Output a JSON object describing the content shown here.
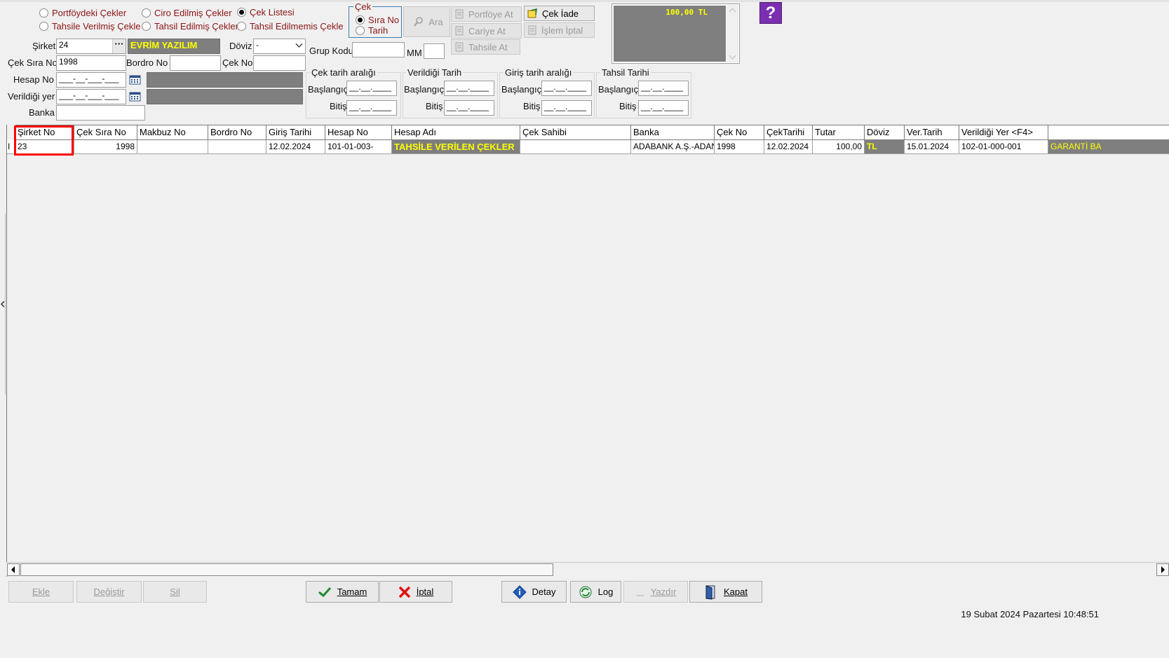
{
  "filters": {
    "radios": [
      {
        "label": "Portföydeki Çekler",
        "selected": false
      },
      {
        "label": "Ciro Edilmiş Çekler",
        "selected": false
      },
      {
        "label": "Çek Listesi",
        "selected": true
      },
      {
        "label": "Tahsile Verilmiş Çekle",
        "selected": false
      },
      {
        "label": "Tahsil Edilmiş Çekler",
        "selected": false
      },
      {
        "label": "Tahsil Edilmemis Çekle",
        "selected": false
      }
    ]
  },
  "form": {
    "sirket_label": "Şirket",
    "sirket_value": "24",
    "sirket_name": "EVRİM YAZILIM",
    "doviz_label": "Döviz",
    "doviz_value": "-",
    "cek_sira_label": "Çek Sıra No",
    "cek_sira_value": "1998",
    "bordro_label": "Bordro No",
    "bordro_value": "",
    "cek_no_label": "Çek No",
    "cek_no_value": "",
    "hesap_label": "Hesap No",
    "hesap_value": "___-__-___-___",
    "verildigi_label": "Verildiği yer",
    "verildigi_value": "___-__-___-___",
    "banka_label": "Banka",
    "banka_value": "",
    "grup_label": "Grup Kodu",
    "grup_value": "",
    "mm_label": "MM",
    "mm_value": ""
  },
  "cek_group": {
    "title": "Çek",
    "opt1": "Sıra No",
    "opt2": "Tarih"
  },
  "buttons": {
    "ara": "Ara",
    "portfoye": "Portföye At",
    "cariye": "Cariye At",
    "tahsile": "Tahsile At",
    "cek_iade": "Çek İade",
    "islem_iptal": "İşlem İptal"
  },
  "total_display": "100,00 TL",
  "date_groups": [
    {
      "title": "Çek tarih aralığı",
      "start_label": "Başlangıç",
      "end_label": "Bitiş",
      "start": "__.__.____",
      "end": "__.__.____"
    },
    {
      "title": "Verildiği Tarih",
      "start_label": "Başlangıç",
      "end_label": "Bitiş",
      "start": "__.__.____",
      "end": "__.__.____"
    },
    {
      "title": "Giriş tarih aralığı",
      "start_label": "Başlangıç",
      "end_label": "Bitiş",
      "start": "__.__.____",
      "end": "__.__.____"
    },
    {
      "title": "Tahsil Tarihi",
      "start_label": "Başlangıç",
      "end_label": "Bitiş",
      "start": "__.__.____",
      "end": "__.__.____"
    }
  ],
  "table": {
    "columns": [
      "Şirket No",
      "Çek Sıra No",
      "Makbuz No",
      "Bordro No",
      "Giriş Tarihi",
      "Hesap No",
      "Hesap Adı",
      "Çek Sahibi",
      "Banka",
      "Çek No",
      "ÇekTarihi",
      "Tutar",
      "Döviz",
      "Ver.Tarih",
      "Verildiği Yer <F4>",
      ""
    ],
    "row_indicator": "I",
    "rows": [
      [
        "23",
        "1998",
        "",
        "",
        "12.02.2024",
        "101-01-003-",
        "TAHSİLE VERİLEN ÇEKLER",
        "",
        "ADABANK A.Ş.-ADANA",
        "1998",
        "12.02.2024",
        "100,00",
        "TL",
        "15.01.2024",
        "102-01-000-001",
        "GARANTİ BA"
      ]
    ]
  },
  "bottom_buttons": {
    "ekle": "Ekle",
    "degistir": "Değiştir",
    "sil": "Sil",
    "tamam": "Tamam",
    "iptal": "İptal",
    "detay": "Detay",
    "log": "Log",
    "yazdir": "Yazdır",
    "kapat": "Kapat"
  },
  "status_text": "19 Subat 2024 Pazartesi 10:48:51",
  "colors": {
    "highlight": "#ff0000",
    "yellow_text": "#ffff00",
    "field_gray": "#7f7f7f",
    "label_red": "#8b1414"
  }
}
